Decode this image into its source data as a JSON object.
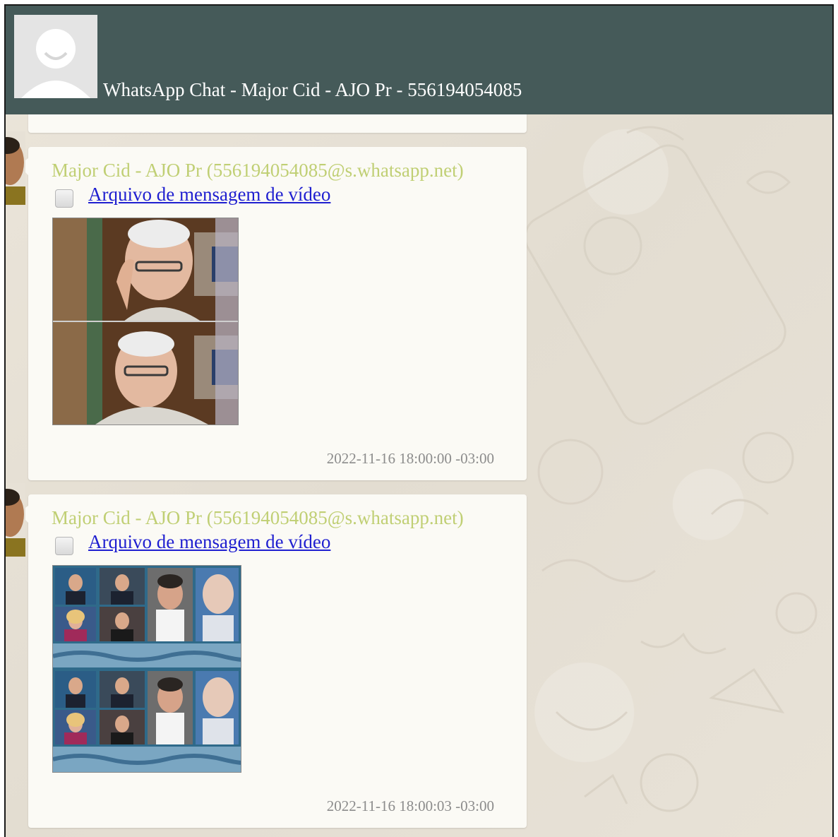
{
  "window": {
    "title": "WhatsApp Chat - Major Cid - AJO Pr - 556194054085",
    "header_color": "#455a59"
  },
  "icons": {
    "header_avatar": "default-user-avatar-icon",
    "checkbox": "checkbox-icon"
  },
  "colors": {
    "sender": "#c0cf74",
    "link": "#1f1fd0",
    "timestamp": "#8c8c8c",
    "bubble": "#fbfaf5"
  },
  "messages": [
    {
      "sender": "Major Cid - AJO Pr (556194054085@s.whatsapp.net)",
      "attachment_label": "Arquivo de mensagem de vídeo",
      "attachment_checked": false,
      "timestamp": "2022-11-16 18:00:00 -03:00"
    },
    {
      "sender": "Major Cid - AJO Pr (556194054085@s.whatsapp.net)",
      "attachment_label": "Arquivo de mensagem de vídeo",
      "attachment_checked": false,
      "timestamp": "2022-11-16 18:00:03 -03:00"
    }
  ]
}
